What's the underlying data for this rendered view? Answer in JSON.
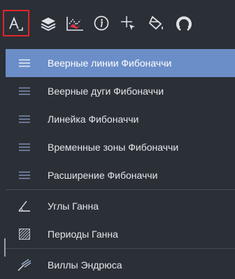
{
  "toolbar": {
    "buttons": [
      {
        "name": "fibonacci-tools-icon",
        "active": true
      },
      {
        "name": "layers-icon",
        "active": false
      },
      {
        "name": "chart-pattern-icon",
        "active": false
      },
      {
        "name": "info-icon",
        "active": false
      },
      {
        "name": "crosshair-cursor-icon",
        "active": false
      },
      {
        "name": "fill-bucket-icon",
        "active": false
      },
      {
        "name": "magnet-icon",
        "active": false
      }
    ]
  },
  "menu": {
    "items": [
      {
        "label": "Веерные линии Фибоначчи",
        "icon": "lines-icon",
        "selected": true
      },
      {
        "label": "Веерные дуги Фибоначчи",
        "icon": "lines-icon",
        "selected": false
      },
      {
        "label": "Линейка Фибоначчи",
        "icon": "lines-icon",
        "selected": false
      },
      {
        "label": "Временные зоны Фибоначчи",
        "icon": "lines-icon",
        "selected": false
      },
      {
        "label": "Расширение Фибоначчи",
        "icon": "lines-icon",
        "selected": false
      },
      {
        "label": "Углы Ганна",
        "icon": "angle-icon",
        "selected": false
      },
      {
        "label": "Периоды Ганна",
        "icon": "hatch-icon",
        "selected": false
      },
      {
        "label": "Виллы Эндрюса",
        "icon": "pitchfork-icon",
        "selected": false
      }
    ]
  },
  "colors": {
    "background": "#2b2f36",
    "selected": "#6b8ec8",
    "active_outline": "#e0252b",
    "text": "#e4e7ec"
  }
}
